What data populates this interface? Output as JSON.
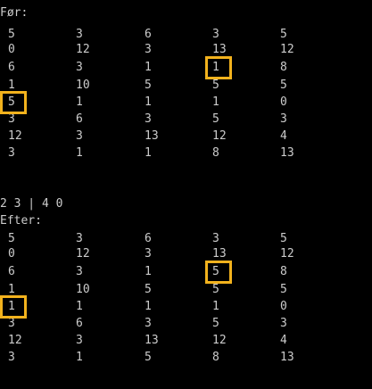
{
  "window": {
    "background": "#000000",
    "text_color": "#cccccc",
    "highlight_color": "#f2b21d"
  },
  "before": {
    "label": "Før:",
    "rows": [
      [
        "5",
        "3",
        "6",
        "3",
        "5"
      ],
      [
        "0",
        "12",
        "3",
        "13",
        "12"
      ],
      [
        "6",
        "3",
        "1",
        "1",
        "8"
      ],
      [
        "1",
        "10",
        "5",
        "5",
        "5"
      ],
      [
        "5",
        "1",
        "1",
        "1",
        "0"
      ],
      [
        "3",
        "6",
        "3",
        "5",
        "3"
      ],
      [
        "12",
        "3",
        "13",
        "12",
        "4"
      ],
      [
        "3",
        "1",
        "1",
        "8",
        "13"
      ]
    ],
    "highlighted_cells": [
      {
        "row": 2,
        "col": 3,
        "value": "1"
      },
      {
        "row": 4,
        "col": 0,
        "value": "5"
      }
    ]
  },
  "swap_line": "2 3 | 4 0",
  "after": {
    "label": "Efter:",
    "rows": [
      [
        "5",
        "3",
        "6",
        "3",
        "5"
      ],
      [
        "0",
        "12",
        "3",
        "13",
        "12"
      ],
      [
        "6",
        "3",
        "1",
        "5",
        "8"
      ],
      [
        "1",
        "10",
        "5",
        "5",
        "5"
      ],
      [
        "1",
        "1",
        "1",
        "1",
        "0"
      ],
      [
        "3",
        "6",
        "3",
        "5",
        "3"
      ],
      [
        "12",
        "3",
        "13",
        "12",
        "4"
      ],
      [
        "3",
        "1",
        "5",
        "8",
        "13"
      ]
    ],
    "highlighted_cells": [
      {
        "row": 2,
        "col": 3,
        "value": "5"
      },
      {
        "row": 4,
        "col": 0,
        "value": "1"
      }
    ]
  }
}
